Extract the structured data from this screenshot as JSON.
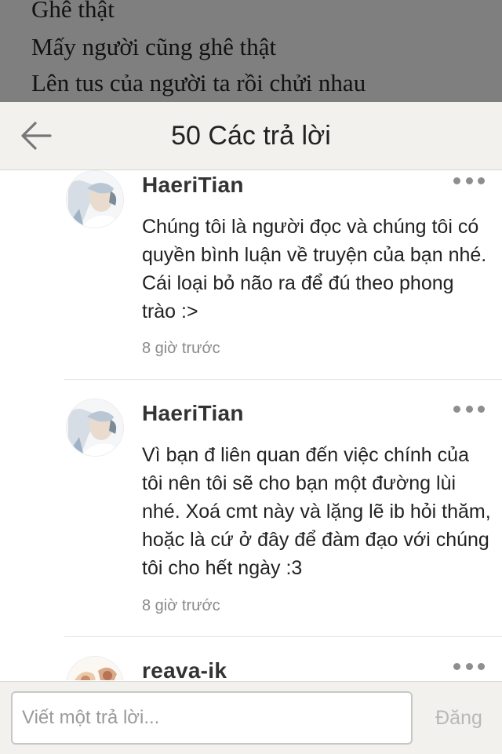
{
  "background_story": {
    "lines": [
      "Ghê thật",
      "Mấy người cũng ghê thật",
      "Lên tus của người ta rồi chửi nhau"
    ]
  },
  "header": {
    "back_icon": "arrow-left-icon",
    "title": "50 Các trả lời"
  },
  "comments": [
    {
      "username": "HaeriTian",
      "text": "Chúng tôi là người đọc và chúng tôi có quyền bình luận về truyện của bạn nhé. Cái loại bỏ não ra để đú theo phong trào :>",
      "time": "8 giờ trước",
      "avatar_icon": "user-avatar"
    },
    {
      "username": "HaeriTian",
      "text": "Vì bạn đ liên quan đến việc chính của tôi nên tôi sẽ cho bạn một đường lùi nhé. Xoá cmt này và lặng lẽ ib hỏi thăm, hoặc là cứ ở đây để đàm đạo với chúng tôi cho hết ngày :3",
      "time": "8 giờ trước",
      "avatar_icon": "user-avatar"
    },
    {
      "username": "reava-ik",
      "avatar_icon": "user-avatar"
    }
  ],
  "more_icon": "more-options-icon",
  "composer": {
    "placeholder": "Viết một trả lời...",
    "post_label": "Đăng"
  },
  "colors": {
    "header_bg": "#f2f1ee",
    "backdrop": "#7f7f7f",
    "divider": "#e3e3e3",
    "muted_text": "#8a8a8a",
    "disabled_button": "#b8b8b8"
  }
}
